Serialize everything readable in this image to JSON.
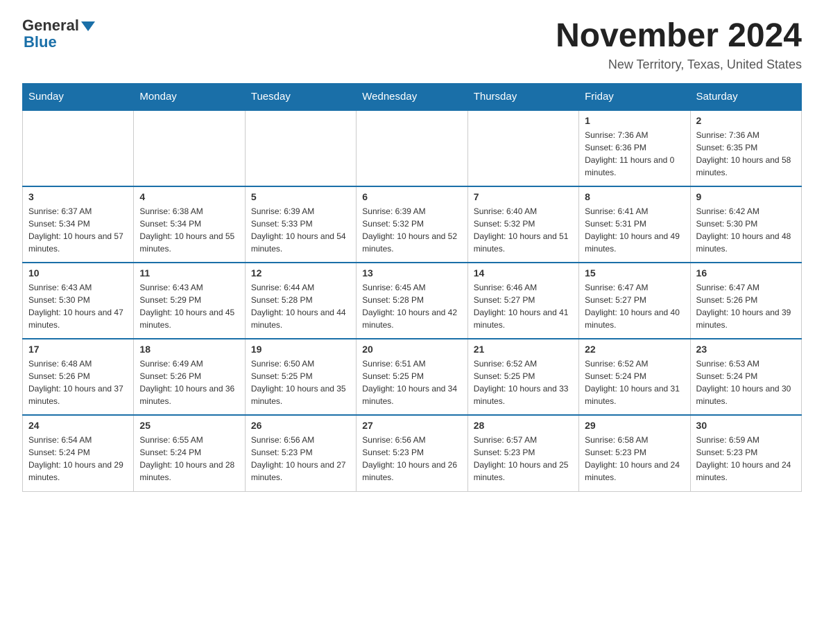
{
  "header": {
    "logo_general": "General",
    "logo_blue": "Blue",
    "month_title": "November 2024",
    "location": "New Territory, Texas, United States"
  },
  "weekdays": [
    "Sunday",
    "Monday",
    "Tuesday",
    "Wednesday",
    "Thursday",
    "Friday",
    "Saturday"
  ],
  "weeks": [
    [
      {
        "day": "",
        "info": ""
      },
      {
        "day": "",
        "info": ""
      },
      {
        "day": "",
        "info": ""
      },
      {
        "day": "",
        "info": ""
      },
      {
        "day": "",
        "info": ""
      },
      {
        "day": "1",
        "info": "Sunrise: 7:36 AM\nSunset: 6:36 PM\nDaylight: 11 hours and 0 minutes."
      },
      {
        "day": "2",
        "info": "Sunrise: 7:36 AM\nSunset: 6:35 PM\nDaylight: 10 hours and 58 minutes."
      }
    ],
    [
      {
        "day": "3",
        "info": "Sunrise: 6:37 AM\nSunset: 5:34 PM\nDaylight: 10 hours and 57 minutes."
      },
      {
        "day": "4",
        "info": "Sunrise: 6:38 AM\nSunset: 5:34 PM\nDaylight: 10 hours and 55 minutes."
      },
      {
        "day": "5",
        "info": "Sunrise: 6:39 AM\nSunset: 5:33 PM\nDaylight: 10 hours and 54 minutes."
      },
      {
        "day": "6",
        "info": "Sunrise: 6:39 AM\nSunset: 5:32 PM\nDaylight: 10 hours and 52 minutes."
      },
      {
        "day": "7",
        "info": "Sunrise: 6:40 AM\nSunset: 5:32 PM\nDaylight: 10 hours and 51 minutes."
      },
      {
        "day": "8",
        "info": "Sunrise: 6:41 AM\nSunset: 5:31 PM\nDaylight: 10 hours and 49 minutes."
      },
      {
        "day": "9",
        "info": "Sunrise: 6:42 AM\nSunset: 5:30 PM\nDaylight: 10 hours and 48 minutes."
      }
    ],
    [
      {
        "day": "10",
        "info": "Sunrise: 6:43 AM\nSunset: 5:30 PM\nDaylight: 10 hours and 47 minutes."
      },
      {
        "day": "11",
        "info": "Sunrise: 6:43 AM\nSunset: 5:29 PM\nDaylight: 10 hours and 45 minutes."
      },
      {
        "day": "12",
        "info": "Sunrise: 6:44 AM\nSunset: 5:28 PM\nDaylight: 10 hours and 44 minutes."
      },
      {
        "day": "13",
        "info": "Sunrise: 6:45 AM\nSunset: 5:28 PM\nDaylight: 10 hours and 42 minutes."
      },
      {
        "day": "14",
        "info": "Sunrise: 6:46 AM\nSunset: 5:27 PM\nDaylight: 10 hours and 41 minutes."
      },
      {
        "day": "15",
        "info": "Sunrise: 6:47 AM\nSunset: 5:27 PM\nDaylight: 10 hours and 40 minutes."
      },
      {
        "day": "16",
        "info": "Sunrise: 6:47 AM\nSunset: 5:26 PM\nDaylight: 10 hours and 39 minutes."
      }
    ],
    [
      {
        "day": "17",
        "info": "Sunrise: 6:48 AM\nSunset: 5:26 PM\nDaylight: 10 hours and 37 minutes."
      },
      {
        "day": "18",
        "info": "Sunrise: 6:49 AM\nSunset: 5:26 PM\nDaylight: 10 hours and 36 minutes."
      },
      {
        "day": "19",
        "info": "Sunrise: 6:50 AM\nSunset: 5:25 PM\nDaylight: 10 hours and 35 minutes."
      },
      {
        "day": "20",
        "info": "Sunrise: 6:51 AM\nSunset: 5:25 PM\nDaylight: 10 hours and 34 minutes."
      },
      {
        "day": "21",
        "info": "Sunrise: 6:52 AM\nSunset: 5:25 PM\nDaylight: 10 hours and 33 minutes."
      },
      {
        "day": "22",
        "info": "Sunrise: 6:52 AM\nSunset: 5:24 PM\nDaylight: 10 hours and 31 minutes."
      },
      {
        "day": "23",
        "info": "Sunrise: 6:53 AM\nSunset: 5:24 PM\nDaylight: 10 hours and 30 minutes."
      }
    ],
    [
      {
        "day": "24",
        "info": "Sunrise: 6:54 AM\nSunset: 5:24 PM\nDaylight: 10 hours and 29 minutes."
      },
      {
        "day": "25",
        "info": "Sunrise: 6:55 AM\nSunset: 5:24 PM\nDaylight: 10 hours and 28 minutes."
      },
      {
        "day": "26",
        "info": "Sunrise: 6:56 AM\nSunset: 5:23 PM\nDaylight: 10 hours and 27 minutes."
      },
      {
        "day": "27",
        "info": "Sunrise: 6:56 AM\nSunset: 5:23 PM\nDaylight: 10 hours and 26 minutes."
      },
      {
        "day": "28",
        "info": "Sunrise: 6:57 AM\nSunset: 5:23 PM\nDaylight: 10 hours and 25 minutes."
      },
      {
        "day": "29",
        "info": "Sunrise: 6:58 AM\nSunset: 5:23 PM\nDaylight: 10 hours and 24 minutes."
      },
      {
        "day": "30",
        "info": "Sunrise: 6:59 AM\nSunset: 5:23 PM\nDaylight: 10 hours and 24 minutes."
      }
    ]
  ]
}
